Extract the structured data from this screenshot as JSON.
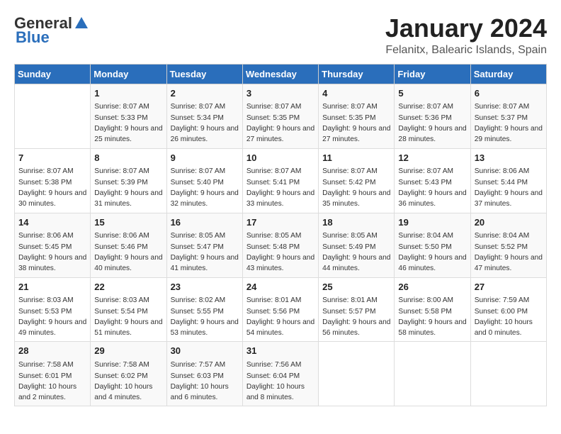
{
  "logo": {
    "general": "General",
    "blue": "Blue"
  },
  "header": {
    "month": "January 2024",
    "location": "Felanitx, Balearic Islands, Spain"
  },
  "weekdays": [
    "Sunday",
    "Monday",
    "Tuesday",
    "Wednesday",
    "Thursday",
    "Friday",
    "Saturday"
  ],
  "weeks": [
    [
      {
        "day": "",
        "sunrise": "",
        "sunset": "",
        "daylight": ""
      },
      {
        "day": "1",
        "sunrise": "Sunrise: 8:07 AM",
        "sunset": "Sunset: 5:33 PM",
        "daylight": "Daylight: 9 hours and 25 minutes."
      },
      {
        "day": "2",
        "sunrise": "Sunrise: 8:07 AM",
        "sunset": "Sunset: 5:34 PM",
        "daylight": "Daylight: 9 hours and 26 minutes."
      },
      {
        "day": "3",
        "sunrise": "Sunrise: 8:07 AM",
        "sunset": "Sunset: 5:35 PM",
        "daylight": "Daylight: 9 hours and 27 minutes."
      },
      {
        "day": "4",
        "sunrise": "Sunrise: 8:07 AM",
        "sunset": "Sunset: 5:35 PM",
        "daylight": "Daylight: 9 hours and 27 minutes."
      },
      {
        "day": "5",
        "sunrise": "Sunrise: 8:07 AM",
        "sunset": "Sunset: 5:36 PM",
        "daylight": "Daylight: 9 hours and 28 minutes."
      },
      {
        "day": "6",
        "sunrise": "Sunrise: 8:07 AM",
        "sunset": "Sunset: 5:37 PM",
        "daylight": "Daylight: 9 hours and 29 minutes."
      }
    ],
    [
      {
        "day": "7",
        "sunrise": "Sunrise: 8:07 AM",
        "sunset": "Sunset: 5:38 PM",
        "daylight": "Daylight: 9 hours and 30 minutes."
      },
      {
        "day": "8",
        "sunrise": "Sunrise: 8:07 AM",
        "sunset": "Sunset: 5:39 PM",
        "daylight": "Daylight: 9 hours and 31 minutes."
      },
      {
        "day": "9",
        "sunrise": "Sunrise: 8:07 AM",
        "sunset": "Sunset: 5:40 PM",
        "daylight": "Daylight: 9 hours and 32 minutes."
      },
      {
        "day": "10",
        "sunrise": "Sunrise: 8:07 AM",
        "sunset": "Sunset: 5:41 PM",
        "daylight": "Daylight: 9 hours and 33 minutes."
      },
      {
        "day": "11",
        "sunrise": "Sunrise: 8:07 AM",
        "sunset": "Sunset: 5:42 PM",
        "daylight": "Daylight: 9 hours and 35 minutes."
      },
      {
        "day": "12",
        "sunrise": "Sunrise: 8:07 AM",
        "sunset": "Sunset: 5:43 PM",
        "daylight": "Daylight: 9 hours and 36 minutes."
      },
      {
        "day": "13",
        "sunrise": "Sunrise: 8:06 AM",
        "sunset": "Sunset: 5:44 PM",
        "daylight": "Daylight: 9 hours and 37 minutes."
      }
    ],
    [
      {
        "day": "14",
        "sunrise": "Sunrise: 8:06 AM",
        "sunset": "Sunset: 5:45 PM",
        "daylight": "Daylight: 9 hours and 38 minutes."
      },
      {
        "day": "15",
        "sunrise": "Sunrise: 8:06 AM",
        "sunset": "Sunset: 5:46 PM",
        "daylight": "Daylight: 9 hours and 40 minutes."
      },
      {
        "day": "16",
        "sunrise": "Sunrise: 8:05 AM",
        "sunset": "Sunset: 5:47 PM",
        "daylight": "Daylight: 9 hours and 41 minutes."
      },
      {
        "day": "17",
        "sunrise": "Sunrise: 8:05 AM",
        "sunset": "Sunset: 5:48 PM",
        "daylight": "Daylight: 9 hours and 43 minutes."
      },
      {
        "day": "18",
        "sunrise": "Sunrise: 8:05 AM",
        "sunset": "Sunset: 5:49 PM",
        "daylight": "Daylight: 9 hours and 44 minutes."
      },
      {
        "day": "19",
        "sunrise": "Sunrise: 8:04 AM",
        "sunset": "Sunset: 5:50 PM",
        "daylight": "Daylight: 9 hours and 46 minutes."
      },
      {
        "day": "20",
        "sunrise": "Sunrise: 8:04 AM",
        "sunset": "Sunset: 5:52 PM",
        "daylight": "Daylight: 9 hours and 47 minutes."
      }
    ],
    [
      {
        "day": "21",
        "sunrise": "Sunrise: 8:03 AM",
        "sunset": "Sunset: 5:53 PM",
        "daylight": "Daylight: 9 hours and 49 minutes."
      },
      {
        "day": "22",
        "sunrise": "Sunrise: 8:03 AM",
        "sunset": "Sunset: 5:54 PM",
        "daylight": "Daylight: 9 hours and 51 minutes."
      },
      {
        "day": "23",
        "sunrise": "Sunrise: 8:02 AM",
        "sunset": "Sunset: 5:55 PM",
        "daylight": "Daylight: 9 hours and 53 minutes."
      },
      {
        "day": "24",
        "sunrise": "Sunrise: 8:01 AM",
        "sunset": "Sunset: 5:56 PM",
        "daylight": "Daylight: 9 hours and 54 minutes."
      },
      {
        "day": "25",
        "sunrise": "Sunrise: 8:01 AM",
        "sunset": "Sunset: 5:57 PM",
        "daylight": "Daylight: 9 hours and 56 minutes."
      },
      {
        "day": "26",
        "sunrise": "Sunrise: 8:00 AM",
        "sunset": "Sunset: 5:58 PM",
        "daylight": "Daylight: 9 hours and 58 minutes."
      },
      {
        "day": "27",
        "sunrise": "Sunrise: 7:59 AM",
        "sunset": "Sunset: 6:00 PM",
        "daylight": "Daylight: 10 hours and 0 minutes."
      }
    ],
    [
      {
        "day": "28",
        "sunrise": "Sunrise: 7:58 AM",
        "sunset": "Sunset: 6:01 PM",
        "daylight": "Daylight: 10 hours and 2 minutes."
      },
      {
        "day": "29",
        "sunrise": "Sunrise: 7:58 AM",
        "sunset": "Sunset: 6:02 PM",
        "daylight": "Daylight: 10 hours and 4 minutes."
      },
      {
        "day": "30",
        "sunrise": "Sunrise: 7:57 AM",
        "sunset": "Sunset: 6:03 PM",
        "daylight": "Daylight: 10 hours and 6 minutes."
      },
      {
        "day": "31",
        "sunrise": "Sunrise: 7:56 AM",
        "sunset": "Sunset: 6:04 PM",
        "daylight": "Daylight: 10 hours and 8 minutes."
      },
      {
        "day": "",
        "sunrise": "",
        "sunset": "",
        "daylight": ""
      },
      {
        "day": "",
        "sunrise": "",
        "sunset": "",
        "daylight": ""
      },
      {
        "day": "",
        "sunrise": "",
        "sunset": "",
        "daylight": ""
      }
    ]
  ]
}
